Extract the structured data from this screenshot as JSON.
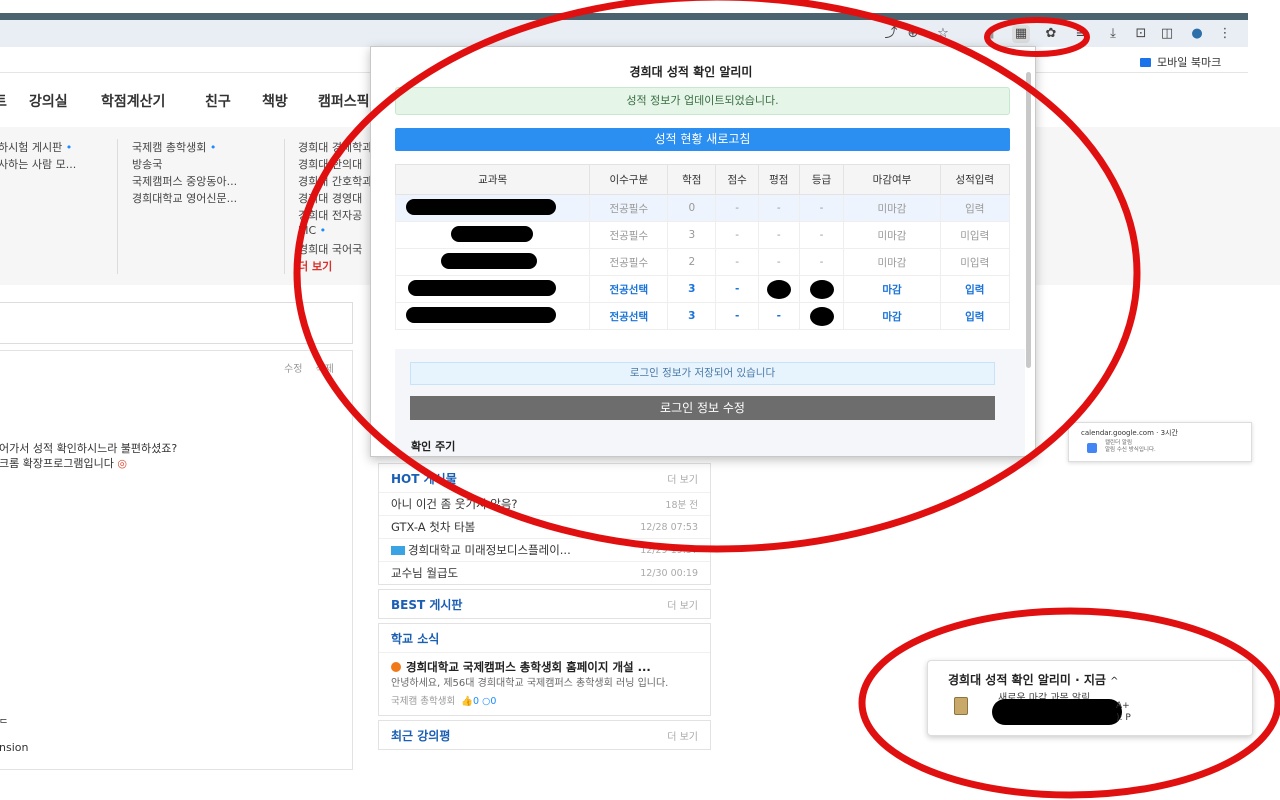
{
  "bookmarks": {
    "mobile": "모바일 북마크"
  },
  "nav": {
    "items": [
      "트",
      "강의실",
      "학점계산기",
      "친구",
      "책방",
      "캠퍼스픽"
    ]
  },
  "boards": {
    "col1": [
      "하시험 게시판",
      "사하는 사람 모..."
    ],
    "col2": [
      "국제캠 총학생회",
      "방송국",
      "국제캠퍼스 중앙동아...",
      "경희대학교 영어신문..."
    ],
    "col3": [
      "경희대 경제학과",
      "경희대 한의대",
      "경희대 간호학과",
      "경희대 경영대",
      "경희대 전자공",
      "KIC",
      "경희대 국어국",
      "더 보기"
    ]
  },
  "post": {
    "actions": [
      "수정",
      "삭제"
    ],
    "line1": "어가서 성적 확인하시느라 불편하셨죠?",
    "line2": "크롬 확장프로그램입니다",
    "frag1": "ᄃ",
    "frag2": "nsion"
  },
  "popup": {
    "title": "경희대 성적 확인 알리미",
    "success": "성적 정보가 업데이트되었습니다.",
    "refresh": "성적 현황 새로고침",
    "headers": [
      "교과목",
      "이수구분",
      "학점",
      "점수",
      "평점",
      "등급",
      "마감여부",
      "성적입력"
    ],
    "rows": [
      {
        "type": "전공필수",
        "credit": "0",
        "score": "-",
        "gpa": "-",
        "grade": "-",
        "closed": "미마감",
        "input": "입력"
      },
      {
        "type": "전공필수",
        "credit": "3",
        "score": "-",
        "gpa": "-",
        "grade": "-",
        "closed": "미마감",
        "input": "미입력"
      },
      {
        "type": "전공필수",
        "credit": "2",
        "score": "-",
        "gpa": "-",
        "grade": "-",
        "closed": "미마감",
        "input": "미입력"
      },
      {
        "type": "전공선택",
        "credit": "3",
        "score": "-",
        "gpa": "",
        "grade": "",
        "closed": "마감",
        "input": "입력"
      },
      {
        "type": "전공선택",
        "credit": "3",
        "score": "-",
        "gpa": "-",
        "grade": "",
        "closed": "마감",
        "input": "입력"
      }
    ],
    "saved": "로그인 정보가 저장되어 있습니다",
    "edit": "로그인 정보 수정",
    "period": "확인 주기"
  },
  "cards": {
    "hot": {
      "title": "HOT 게시물",
      "more": "더 보기",
      "rows": [
        {
          "title": "아니 이건 좀 웃기지 않음?",
          "time": "18분 전"
        },
        {
          "title": "GTX-A 첫차 타봄",
          "time": "12/28 07:53"
        },
        {
          "title": "경희대학교 미래정보디스플레이...",
          "time": "12/29 19:37"
        },
        {
          "title": "교수님 월급도",
          "time": "12/30 00:19"
        }
      ]
    },
    "best": {
      "title": "BEST 게시판",
      "more": "더 보기"
    },
    "school": {
      "title": "학교 소식",
      "news_title": "경희대학교 국제캠퍼스 총학생회 홈페이지 개설 ...",
      "news_body": "안녕하세요, 제56대 경희대학교 국제캠퍼스 총학생회 러닝 입니다.",
      "news_author": "국제캠 총학생회",
      "likes": "0",
      "comments": "0"
    },
    "review": {
      "title": "최근 강의평",
      "more": "더 보기"
    }
  },
  "calendar_toast": {
    "head": "calendar.google.com · 3시간",
    "line1": "캘린더 알림",
    "line2": "알림 수신 방식입니다."
  },
  "notification": {
    "title": "경희대 성적 확인 알리미 · 지금",
    "line1": "새로운 마감 과목 알림",
    "grade1": "A+",
    "grade2": "): P"
  },
  "icons": [
    "share-icon",
    "star-icon",
    "extension-grade-icon",
    "puzzle-icon",
    "download-icon",
    "screenshot-icon",
    "split-icon",
    "profile-icon",
    "menu-icon"
  ],
  "colors": {
    "accent": "#2b8ef1",
    "annotation": "#e01010",
    "closed_blue": "#1a73d9"
  }
}
